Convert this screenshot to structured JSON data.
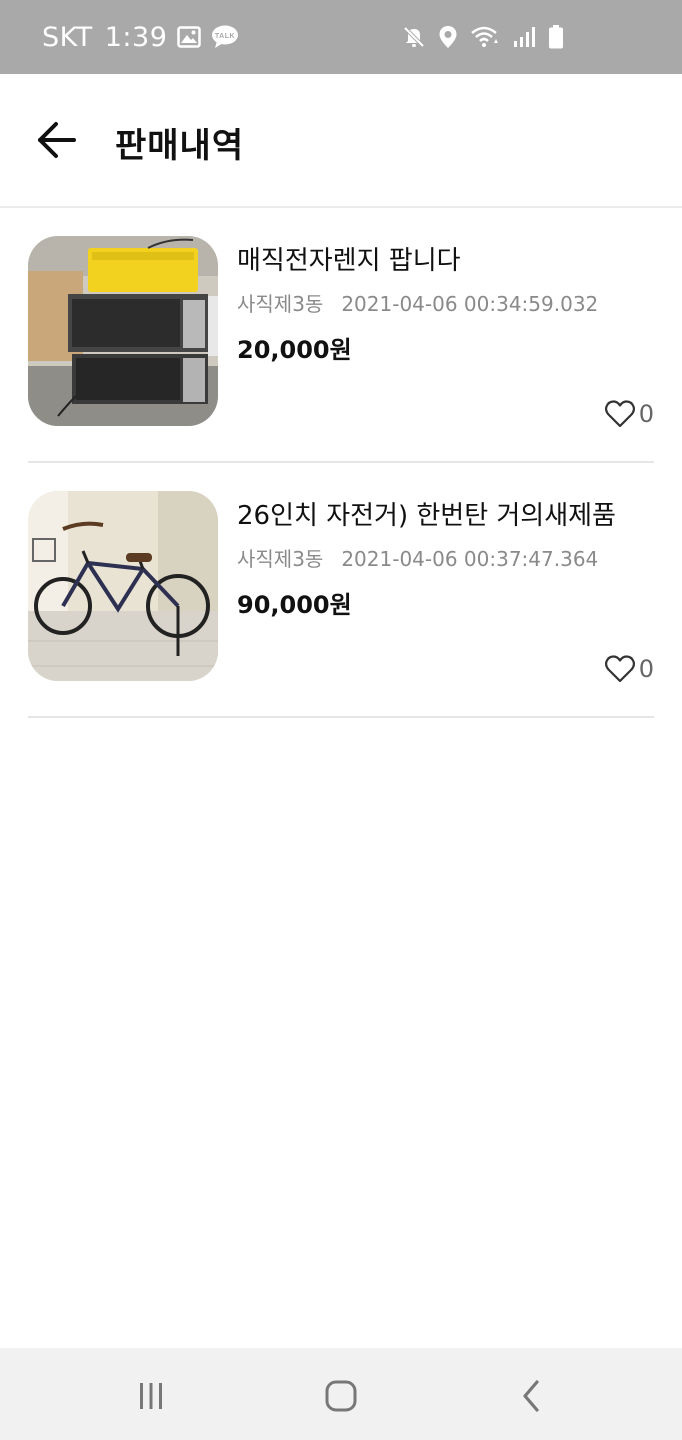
{
  "status_bar": {
    "carrier": "SKT",
    "time": "1:39",
    "icons": [
      "image-icon",
      "talk-icon",
      "mute-icon",
      "location-icon",
      "wifi-icon",
      "signal-icon",
      "battery-icon"
    ]
  },
  "app_bar": {
    "title": "판매내역",
    "back_icon": "arrow-left-icon"
  },
  "items": [
    {
      "title": "매직전자렌지 팝니다",
      "location": "사직제3동",
      "timestamp": "2021-04-06 00:34:59.032",
      "price": "20,000원",
      "likes": "0",
      "thumbnail": "microwave-photo"
    },
    {
      "title": "26인치 자전거) 한번탄 거의새제품",
      "location": "사직제3동",
      "timestamp": "2021-04-06 00:37:47.364",
      "price": "90,000원",
      "likes": "0",
      "thumbnail": "bicycle-photo"
    }
  ],
  "nav_bar": {
    "recent_icon": "recent-apps-icon",
    "home_icon": "home-icon",
    "back_icon": "back-chevron-icon"
  },
  "colors": {
    "status_bar_bg": "#a9a9a9",
    "nav_bar_bg": "#f1f1f1",
    "meta_text": "#8a8a8a",
    "divider": "#e6e6e6"
  }
}
